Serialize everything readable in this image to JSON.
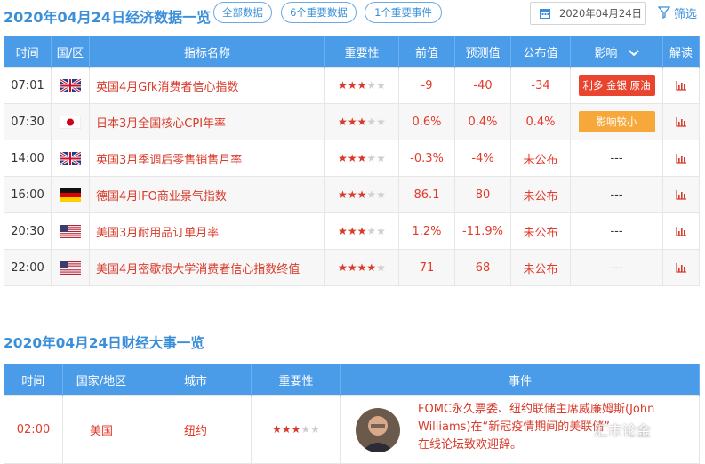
{
  "header": {
    "title": "2020年04月24日经济数据一览",
    "filters": [
      "全部数据",
      "6个重要数据",
      "1个重要事件"
    ],
    "date": "2020年04月24日",
    "filter_label": "筛选"
  },
  "data_table": {
    "columns": [
      "时间",
      "国/区",
      "指标名称",
      "重要性",
      "前值",
      "预测值",
      "公布值",
      "影响",
      "解读"
    ],
    "rows": [
      {
        "time": "07:01",
        "country": "uk",
        "name": "英国4月Gfk消费者信心指数",
        "stars": 3,
        "prev": "-9",
        "forecast": "-40",
        "actual": "-34",
        "impact": "利多 金银 原油",
        "impact_style": "red"
      },
      {
        "time": "07:30",
        "country": "jp",
        "name": "日本3月全国核心CPI年率",
        "stars": 3,
        "prev": "0.6%",
        "forecast": "0.4%",
        "actual": "0.4%",
        "impact": "影响较小",
        "impact_style": "orange"
      },
      {
        "time": "14:00",
        "country": "uk",
        "name": "英国3月季调后零售销售月率",
        "stars": 3,
        "prev": "-0.3%",
        "forecast": "-4%",
        "actual": "未公布",
        "impact": "---",
        "impact_style": "none"
      },
      {
        "time": "16:00",
        "country": "de",
        "name": "德国4月IFO商业景气指数",
        "stars": 3,
        "prev": "86.1",
        "forecast": "80",
        "actual": "未公布",
        "impact": "---",
        "impact_style": "none"
      },
      {
        "time": "20:30",
        "country": "us",
        "name": "美国3月耐用品订单月率",
        "stars": 3,
        "prev": "1.2%",
        "forecast": "-11.9%",
        "actual": "未公布",
        "impact": "---",
        "impact_style": "none"
      },
      {
        "time": "22:00",
        "country": "us",
        "name": "美国4月密歇根大学消费者信心指数终值",
        "stars": 4,
        "prev": "71",
        "forecast": "68",
        "actual": "未公布",
        "impact": "---",
        "impact_style": "none"
      }
    ]
  },
  "events_section": {
    "title": "2020年04月24日财经大事一览",
    "columns": [
      "时间",
      "国家/地区",
      "城市",
      "重要性",
      "事件"
    ],
    "rows": [
      {
        "time": "02:00",
        "country": "美国",
        "city": "纽约",
        "stars": 3,
        "event_lines": [
          "FOMC永久票委、纽约联储主席威廉姆斯(John",
          "Williams)在“新冠疫情期间的美联储”",
          "在线论坛致欢迎辞。"
        ]
      }
    ]
  },
  "watermark": "汇市论金",
  "colors": {
    "header_blue": "#4a9be8",
    "title_blue": "#3b8fd9",
    "red": "#d83b2b",
    "orange": "#f7a83a"
  }
}
